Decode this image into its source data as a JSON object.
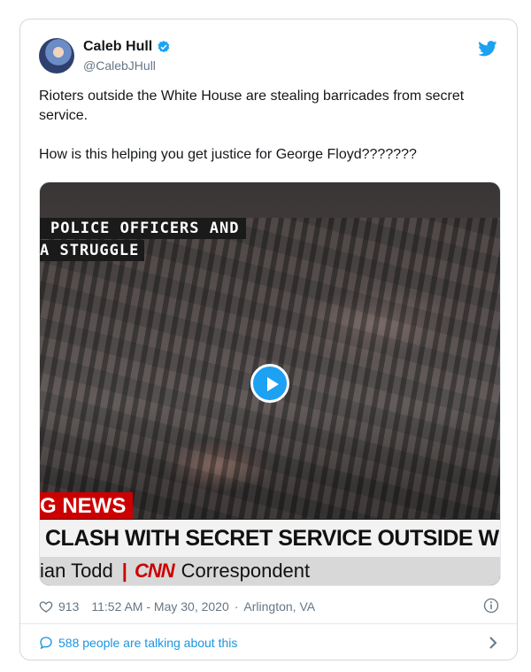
{
  "author": {
    "display_name": "Caleb Hull",
    "handle": "@CalebJHull",
    "verified": true
  },
  "tweet": {
    "line1": "Rioters outside the White House are stealing barricades from secret service.",
    "line2": "How is this helping you get justice for George Floyd???????"
  },
  "video": {
    "chyron_top_1": "POLICE OFFICERS AND",
    "chyron_top_2": "A STRUGGLE",
    "breaking": "G NEWS",
    "headline": "CLASH WITH SECRET SERVICE OUTSIDE WHITE H",
    "byline_name": "ian Todd",
    "byline_sep": "|",
    "network": "CNN",
    "byline_role": "Correspondent"
  },
  "meta": {
    "likes": "913",
    "time": "11:52 AM - May 30, 2020",
    "dot": "·",
    "location": "Arlington, VA"
  },
  "footer": {
    "talking": "588 people are talking about this"
  },
  "colors": {
    "twitter_blue": "#1da1f2",
    "link_blue": "#1b95e0",
    "muted": "#657786",
    "cnn_red": "#cc0000"
  },
  "icons": [
    "verified-badge-icon",
    "twitter-bird-icon",
    "play-icon",
    "heart-icon",
    "info-icon",
    "speech-bubble-icon",
    "chevron-right-icon"
  ]
}
